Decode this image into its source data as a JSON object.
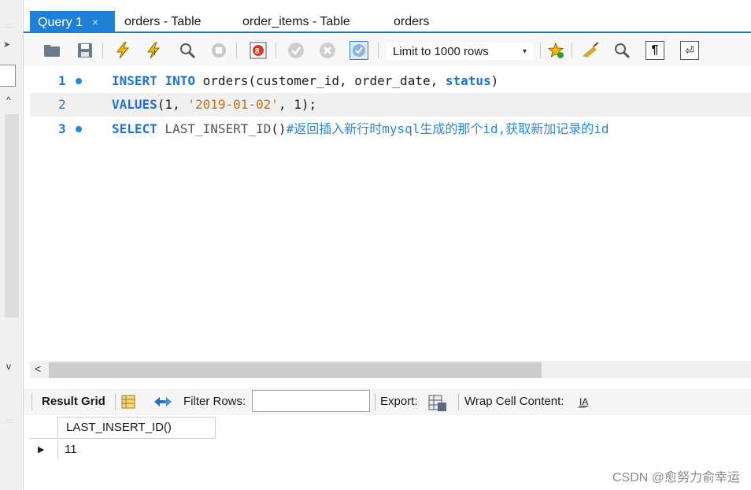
{
  "tabs": [
    {
      "label": "Query 1",
      "active": true,
      "close": "×"
    },
    {
      "label": "orders - Table"
    },
    {
      "label": "order_items - Table"
    },
    {
      "label": "orders"
    }
  ],
  "toolbar": {
    "icons": [
      "open-folder-icon",
      "save-icon",
      "execute-icon",
      "execute-current-icon",
      "explain-icon",
      "stop-icon",
      "toggle-error-icon",
      "commit-icon",
      "rollback-icon",
      "autocommit-icon",
      "beautify-star-icon",
      "broom-icon",
      "find-icon",
      "invisible-chars-icon",
      "wrap-icon"
    ],
    "limit": "Limit to 1000 rows",
    "caret": "▾"
  },
  "editor": {
    "lines": [
      {
        "num": "1"
      },
      {
        "num": "2"
      },
      {
        "num": "3"
      }
    ],
    "tokens": {
      "l1_kw1": "INSERT",
      "l1_kw2": "INTO",
      "l1_rest": " orders(customer_id, order_date, ",
      "l1_kw3": "status",
      "l1_end": ")",
      "l2_kw": "VALUES",
      "l2_a": "(1, ",
      "l2_str": "'2019-01-02'",
      "l2_b": ", 1);",
      "l3_kw": "SELECT",
      "l3_fn": " LAST_INSERT_ID",
      "l3_paren": "()",
      "l3_cm": "#返回插入新行时mysql生成的那个id,获取新加记录的id"
    }
  },
  "left": {
    "up": "^",
    "down": "v",
    "grip": "::::"
  },
  "hscroll": {
    "left_arrow": "<"
  },
  "result_bar": {
    "grid_label": "Result Grid",
    "filter_label": "Filter Rows:",
    "filter_value": "",
    "export_label": "Export:",
    "wrap_label": "Wrap Cell Content:",
    "wrap_icon": "I͟A"
  },
  "grid": {
    "columns": [
      "LAST_INSERT_ID()"
    ],
    "rows": [
      [
        "11"
      ]
    ],
    "row_marker": "▶"
  },
  "watermark": "CSDN @愈努力俞幸运"
}
